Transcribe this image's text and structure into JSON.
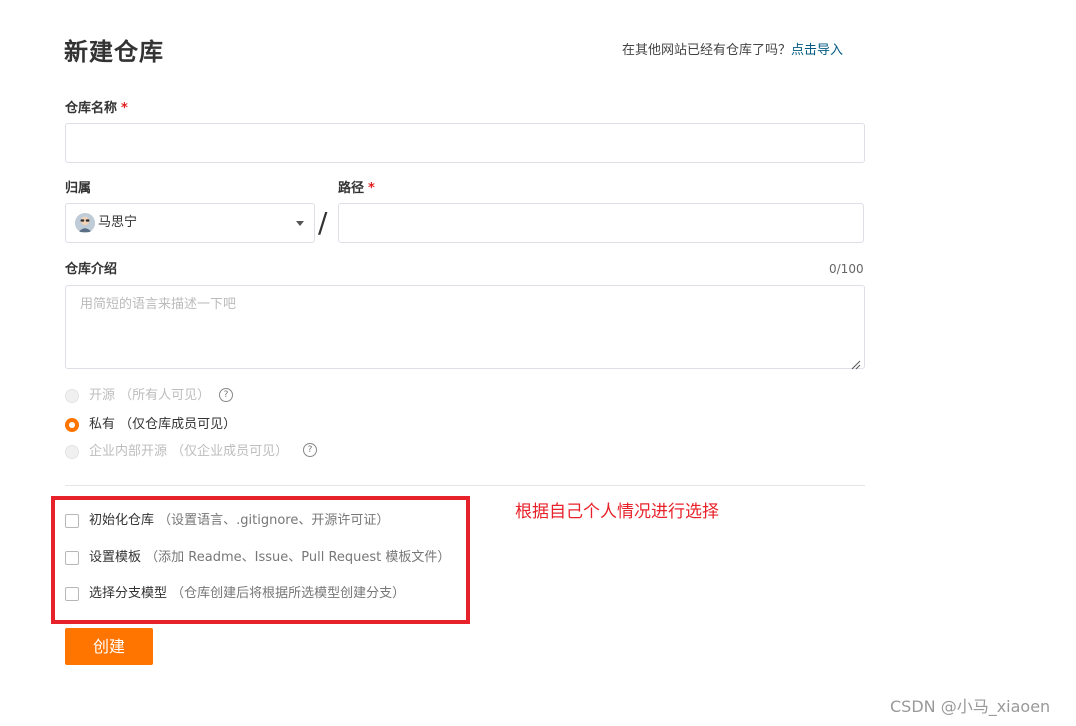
{
  "header": {
    "title": "新建仓库",
    "import_prompt": "在其他网站已经有仓库了吗？",
    "import_link": "点击导入"
  },
  "form": {
    "repo_name": {
      "label": "仓库名称",
      "required_mark": "*",
      "value": ""
    },
    "owner": {
      "label": "归属",
      "value": "马思宁",
      "icon": "avatar"
    },
    "path": {
      "label": "路径",
      "required_mark": "*",
      "value": ""
    },
    "separator": "/",
    "description": {
      "label": "仓库介绍",
      "counter": "0/100",
      "placeholder": "用简短的语言来描述一下吧",
      "value": ""
    },
    "visibility": {
      "options": [
        {
          "label": "开源",
          "hint": "（所有人可见）",
          "state": "disabled",
          "has_help": true
        },
        {
          "label": "私有",
          "hint": "（仅仓库成员可见）",
          "state": "checked",
          "has_help": false
        },
        {
          "label": "企业内部开源",
          "hint": "（仅企业成员可见）",
          "state": "disabled",
          "has_help": true
        }
      ],
      "help_glyph": "?"
    },
    "init_options": [
      {
        "label": "初始化仓库",
        "hint": "（设置语言、.gitignore、开源许可证）",
        "checked": false
      },
      {
        "label": "设置模板",
        "hint": "（添加 Readme、Issue、Pull Request 模板文件）",
        "checked": false
      },
      {
        "label": "选择分支模型",
        "hint": "（仓库创建后将根据所选模型创建分支）",
        "checked": false
      }
    ],
    "submit_label": "创建"
  },
  "annotation": {
    "text": "根据自己个人情况进行选择",
    "color": "#e8222a"
  },
  "watermark": "CSDN @小马_xiaoen",
  "colors": {
    "accent": "#ff7500",
    "link": "#005980",
    "required": "#e11d21"
  }
}
